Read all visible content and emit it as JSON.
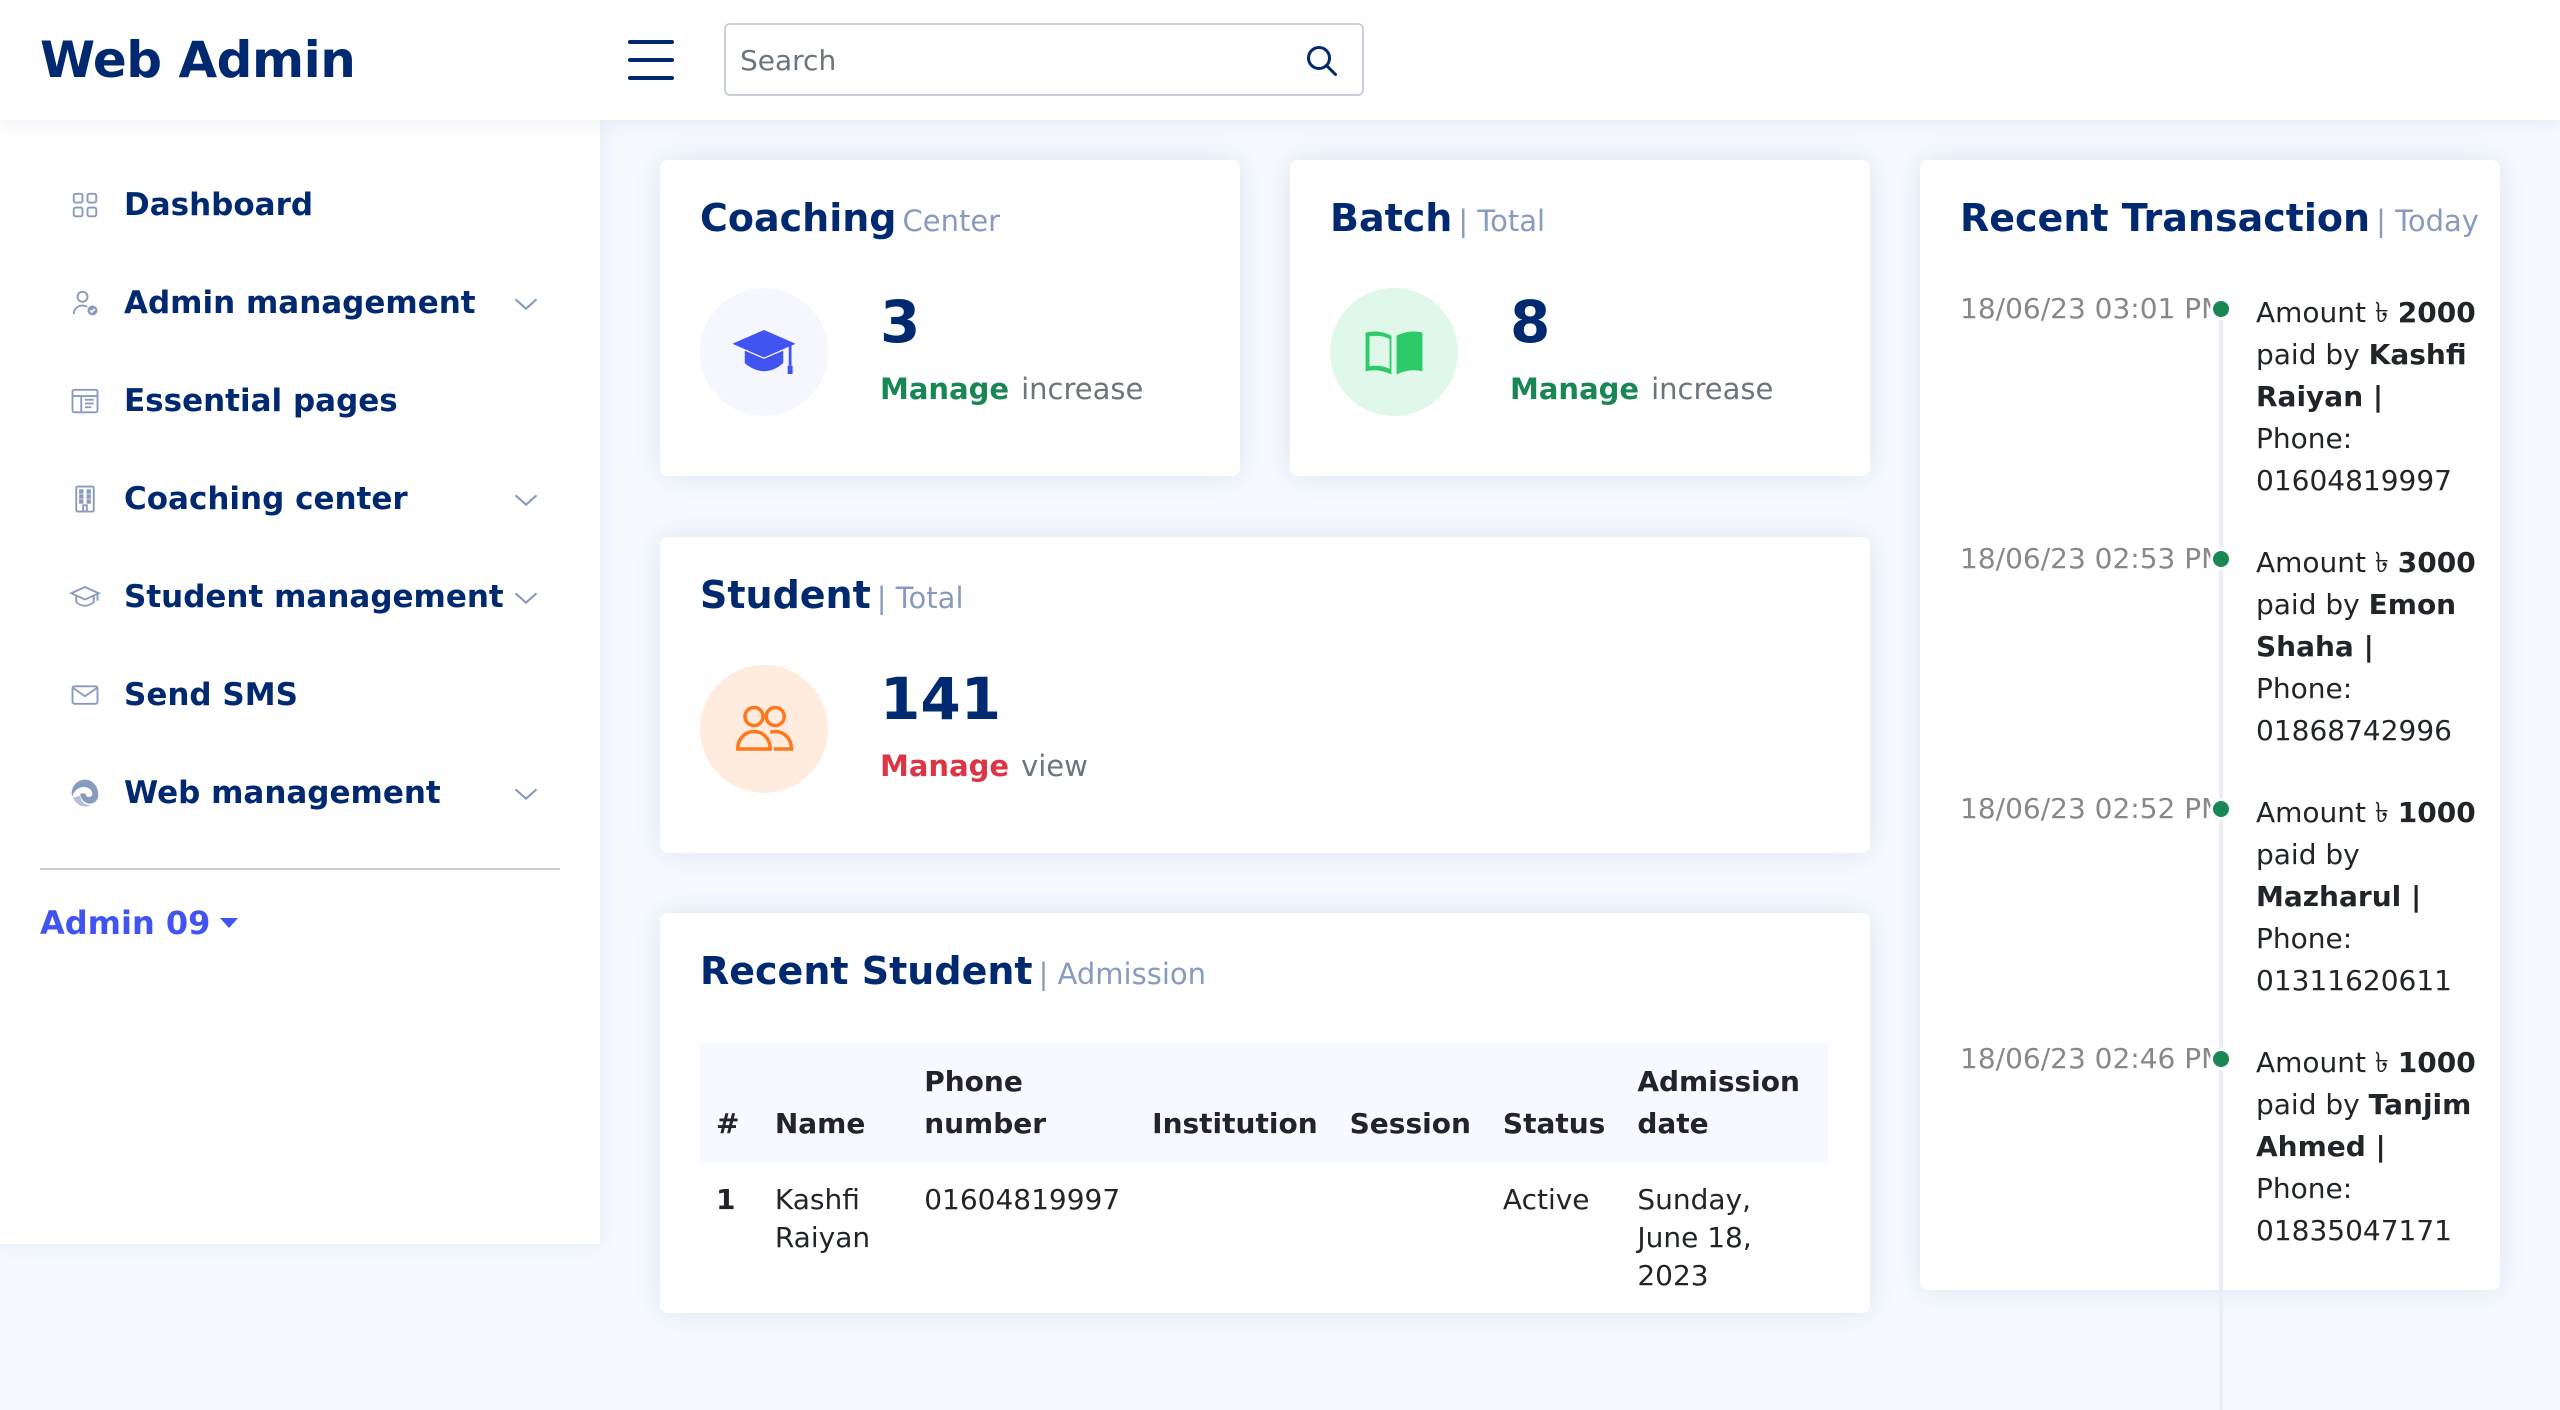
{
  "header": {
    "logo": "Web Admin",
    "search_placeholder": "Search"
  },
  "sidebar": {
    "items": [
      {
        "label": "Dashboard",
        "icon": "grid-icon",
        "expandable": false
      },
      {
        "label": "Admin management",
        "icon": "person-check-icon",
        "expandable": true
      },
      {
        "label": "Essential pages",
        "icon": "layout-text-icon",
        "expandable": false
      },
      {
        "label": "Coaching center",
        "icon": "building-icon",
        "expandable": true
      },
      {
        "label": "Student management",
        "icon": "mortarboard-icon",
        "expandable": true
      },
      {
        "label": "Send SMS",
        "icon": "envelope-icon",
        "expandable": false
      },
      {
        "label": "Web management",
        "icon": "edge-icon",
        "expandable": true
      }
    ],
    "user": "Admin 09"
  },
  "cards": {
    "coaching": {
      "title": "Coaching",
      "sub": "Center",
      "value": "3",
      "manage": "Manage",
      "note": "increase",
      "icon": "mortarboard-icon",
      "color": "#4154f1",
      "bg": "#f6f6fe"
    },
    "batch": {
      "title": "Batch",
      "sub": "| Total",
      "value": "8",
      "manage": "Manage",
      "note": "increase",
      "icon": "book-icon",
      "color": "#2eca6a",
      "bg": "#e0f8e9"
    },
    "student": {
      "title": "Student",
      "sub": "| Total",
      "value": "141",
      "manage": "Manage",
      "note": "view",
      "icon": "people-icon",
      "color": "#ff771d",
      "bg": "#ffecdf"
    }
  },
  "colors": {
    "manage_green": "#198754",
    "manage_red": "#dc3545"
  },
  "recent_student": {
    "title": "Recent Student",
    "sub": "| Admission",
    "columns": [
      "#",
      "Name",
      "Phone number",
      "Institution",
      "Session",
      "Status",
      "Admission date"
    ],
    "rows": [
      {
        "num": "1",
        "name": "Kashfi Raiyan",
        "phone": "01604819997",
        "institution": "",
        "session": "",
        "status": "Active",
        "date": "Sunday, June 18, 2023"
      }
    ]
  },
  "transactions": {
    "title": "Recent Transaction",
    "sub": "| Today",
    "items": [
      {
        "time": "18/06/23 03:01 PM",
        "amount_prefix": "Amount ৳",
        "amount": "2000",
        "paid_by": "paid by",
        "name": "Kashfi Raiyan |",
        "phone_label": "Phone:",
        "phone": "01604819997"
      },
      {
        "time": "18/06/23 02:53 PM",
        "amount_prefix": "Amount ৳",
        "amount": "3000",
        "paid_by": "paid by",
        "name": "Emon Shaha |",
        "phone_label": "Phone:",
        "phone": "01868742996"
      },
      {
        "time": "18/06/23 02:52 PM",
        "amount_prefix": "Amount ৳",
        "amount": "1000",
        "paid_by": "paid by",
        "name": "Mazharul |",
        "phone_label": "Phone:",
        "phone": "01311620611"
      },
      {
        "time": "18/06/23 02:46 PM",
        "amount_prefix": "Amount ৳",
        "amount": "1000",
        "paid_by": "paid by",
        "name": "Tanjim Ahmed |",
        "phone_label": "Phone:",
        "phone": "01835047171"
      }
    ]
  }
}
